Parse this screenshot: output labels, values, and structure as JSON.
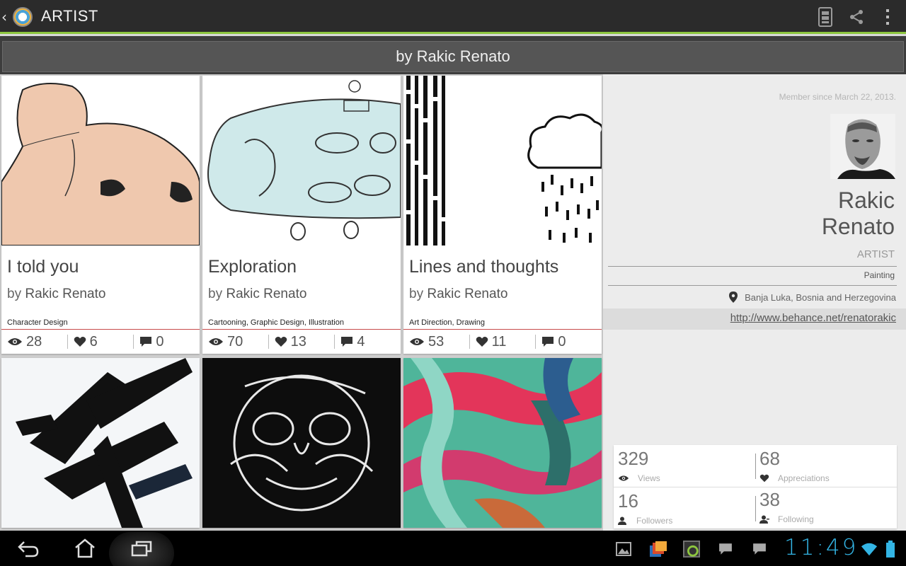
{
  "actionbar": {
    "title": "ARTIST"
  },
  "subheader": {
    "text": "by Rakic Renato"
  },
  "projects": [
    {
      "title": "I told you",
      "by": "by",
      "author": "Rakic Renato",
      "fields": "Character Design",
      "views": "28",
      "appreciations": "6",
      "comments": "0"
    },
    {
      "title": "Exploration",
      "by": "by",
      "author": "Rakic Renato",
      "fields": "Cartooning, Graphic Design, Illustration",
      "views": "70",
      "appreciations": "13",
      "comments": "4"
    },
    {
      "title": "Lines and thoughts",
      "by": "by",
      "author": "Rakic Renato",
      "fields": "Art Direction, Drawing",
      "views": "53",
      "appreciations": "11",
      "comments": "0"
    }
  ],
  "profile": {
    "member_since": "Member since March 22, 2013.",
    "first_name": "Rakic",
    "last_name": "Renato",
    "role": "ARTIST",
    "field": "Painting",
    "location": "Banja Luka, Bosnia and Herzegovina",
    "url": "http://www.behance.net/renatorakic",
    "stats": {
      "views": "329",
      "views_label": "Views",
      "appreciations": "68",
      "appreciations_label": "Appreciations",
      "followers": "16",
      "followers_label": "Followers",
      "following": "38",
      "following_label": "Following"
    }
  },
  "system": {
    "clock": "11:49"
  },
  "colors": {
    "accent": "#8dc63f",
    "divider_red": "#c74b4b",
    "clock": "#33b5e5"
  }
}
